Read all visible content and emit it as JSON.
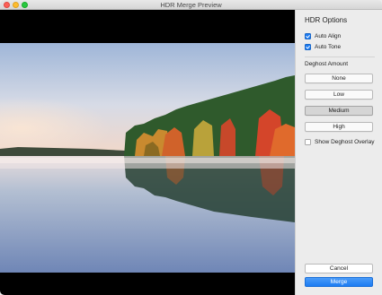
{
  "window": {
    "title": "HDR Merge Preview",
    "accent_color": "#1d7cf2"
  },
  "preview": {
    "image_description_icon": "hdr-landscape-photo"
  },
  "options": {
    "heading": "HDR Options",
    "auto_align": {
      "label": "Auto Align",
      "checked": true
    },
    "auto_tone": {
      "label": "Auto Tone",
      "checked": true
    },
    "deghost_heading": "Deghost Amount",
    "deghost_levels": [
      {
        "label": "None",
        "selected": false
      },
      {
        "label": "Low",
        "selected": false
      },
      {
        "label": "Medium",
        "selected": true
      },
      {
        "label": "High",
        "selected": false
      }
    ],
    "show_overlay": {
      "label": "Show Deghost Overlay",
      "checked": false
    }
  },
  "actions": {
    "cancel_label": "Cancel",
    "merge_label": "Merge"
  }
}
